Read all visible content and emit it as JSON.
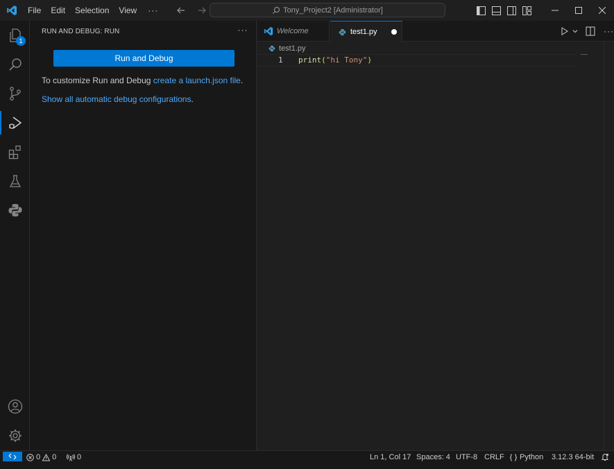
{
  "titlebar": {
    "menu": [
      "File",
      "Edit",
      "Selection",
      "View"
    ],
    "more": "···",
    "command_center": "Tony_Project2 [Administrator]"
  },
  "activitybar": {
    "explorer_badge": "1"
  },
  "sidebar": {
    "title": "RUN AND DEBUG: RUN",
    "more": "···",
    "run_button": "Run and Debug",
    "customize_text": "To customize Run and Debug ",
    "launch_link": "create a launch.json file",
    "launch_suffix": ".",
    "show_all_link": "Show all automatic debug configurations",
    "show_all_suffix": "."
  },
  "editor": {
    "tabs": [
      {
        "label": "Welcome",
        "active": false
      },
      {
        "label": "test1.py",
        "active": true,
        "dirty": true
      }
    ],
    "breadcrumb": "test1.py",
    "lines": [
      {
        "number": "1",
        "fn": "print",
        "open": "(",
        "str": "\"hi Tony\"",
        "close": ")"
      }
    ]
  },
  "statusbar": {
    "errors": "0",
    "warnings": "0",
    "ports": "0",
    "position": "Ln 1, Col 17",
    "spaces": "Spaces: 4",
    "encoding": "UTF-8",
    "eol": "CRLF",
    "language": "Python",
    "interpreter": "3.12.3 64-bit"
  },
  "colors": {
    "accent": "#0078d4",
    "link": "#4daafc",
    "python_blue": "#519aba"
  }
}
